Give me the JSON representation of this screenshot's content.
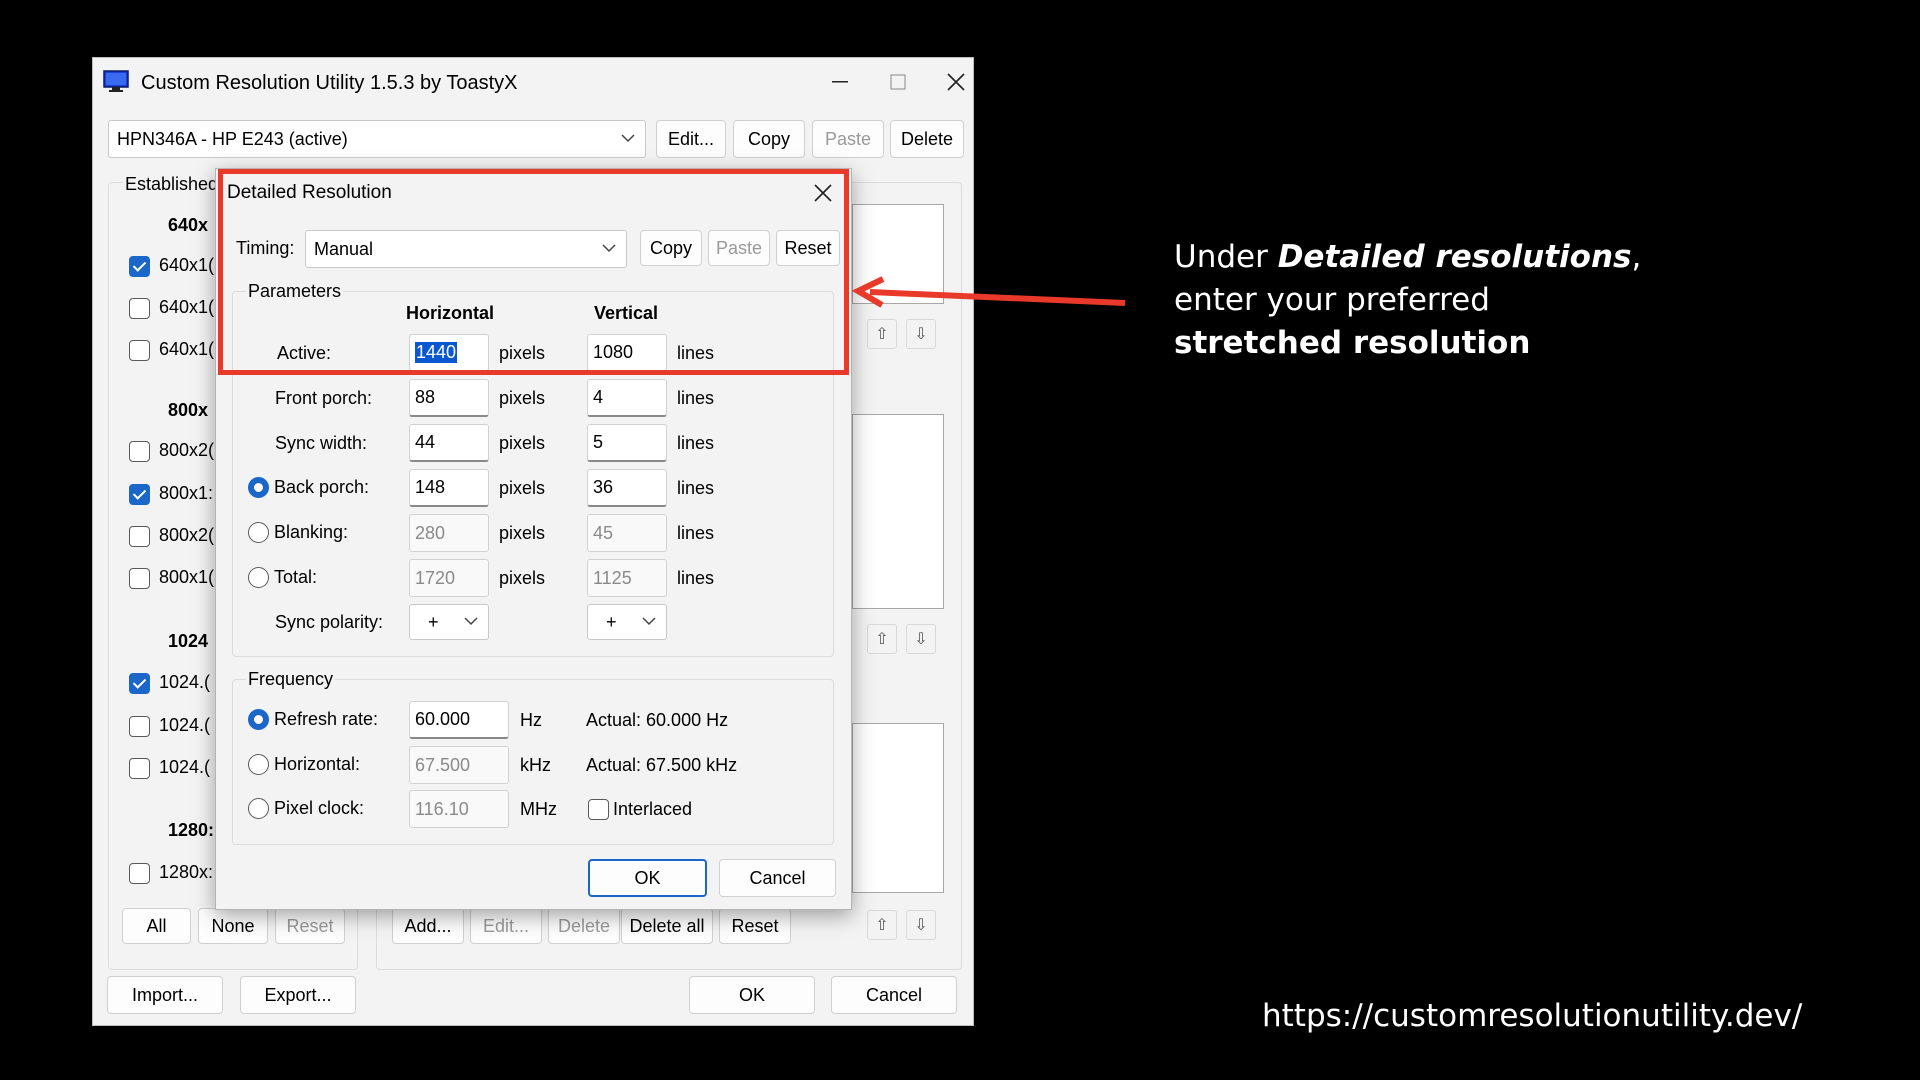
{
  "window": {
    "title": "Custom Resolution Utility 1.5.3 by ToastyX",
    "monitor_select": "HPN346A - HP E243 (active)",
    "edit_label": "Edit...",
    "copy_label": "Copy",
    "paste_label": "Paste",
    "delete_label": "Delete"
  },
  "established": {
    "title": "Established",
    "groups": [
      {
        "header": "640x",
        "items": [
          {
            "label": "640x1(",
            "checked": true
          },
          {
            "label": "640x1(",
            "checked": false
          },
          {
            "label": "640x1(",
            "checked": false
          }
        ]
      },
      {
        "header": "800x",
        "items": [
          {
            "label": "800x2(",
            "checked": false
          },
          {
            "label": "800x1:",
            "checked": true
          },
          {
            "label": "800x2(",
            "checked": false
          },
          {
            "label": "800x1(",
            "checked": false
          }
        ]
      },
      {
        "header": "1024",
        "items": [
          {
            "label": "1024.(",
            "checked": true
          },
          {
            "label": "1024.(",
            "checked": false
          },
          {
            "label": "1024.(",
            "checked": false
          }
        ]
      },
      {
        "header": "1280:",
        "items": [
          {
            "label": "1280x:",
            "checked": false
          }
        ]
      }
    ],
    "all_label": "All",
    "none_label": "None",
    "reset_label": "Reset"
  },
  "bottom_row": {
    "add_label": "Add...",
    "edit_label": "Edit...",
    "delete_label": "Delete",
    "delete_all_label": "Delete all",
    "reset_label": "Reset"
  },
  "footer": {
    "import_label": "Import...",
    "export_label": "Export...",
    "ok_label": "OK",
    "cancel_label": "Cancel"
  },
  "dialog": {
    "title": "Detailed Resolution",
    "timing_label": "Timing:",
    "timing_value": "Manual",
    "copy_label": "Copy",
    "paste_label": "Paste",
    "reset_label": "Reset",
    "parameters_title": "Parameters",
    "horizontal_header": "Horizontal",
    "vertical_header": "Vertical",
    "h_unit": "pixels",
    "v_unit": "lines",
    "rows": {
      "active": {
        "label": "Active:",
        "h": "1440",
        "v": "1080"
      },
      "front_porch": {
        "label": "Front porch:",
        "h": "88",
        "v": "4"
      },
      "sync_width": {
        "label": "Sync width:",
        "h": "44",
        "v": "5"
      },
      "back_porch": {
        "label": "Back porch:",
        "h": "148",
        "v": "36"
      },
      "blanking": {
        "label": "Blanking:",
        "h": "280",
        "v": "45"
      },
      "total": {
        "label": "Total:",
        "h": "1720",
        "v": "1125"
      }
    },
    "sync_polarity_label": "Sync polarity:",
    "sync_polarity_h": "+",
    "sync_polarity_v": "+",
    "frequency_title": "Frequency",
    "refresh_label": "Refresh rate:",
    "refresh_value": "60.000",
    "refresh_unit": "Hz",
    "refresh_actual": "Actual: 60.000 Hz",
    "horizontal_label": "Horizontal:",
    "horizontal_value": "67.500",
    "horizontal_unit": "kHz",
    "horizontal_actual": "Actual: 67.500 kHz",
    "pixel_clock_label": "Pixel clock:",
    "pixel_clock_value": "116.10",
    "pixel_clock_unit": "MHz",
    "interlaced_label": "Interlaced",
    "ok_label": "OK",
    "cancel_label": "Cancel"
  },
  "annotation": {
    "line1_prefix": "Under ",
    "line1_emph": "Detailed resolutions",
    "line1_suffix": ",",
    "line2": "enter your preferred",
    "line3": "stretched resolution"
  },
  "url": "https://customresolutionutility.dev/",
  "colors": {
    "highlight": "#e8392b",
    "accent": "#1a66c9"
  }
}
